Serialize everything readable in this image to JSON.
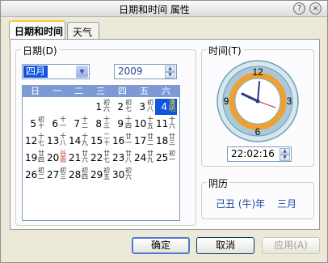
{
  "window": {
    "title": "日期和时间 属性",
    "help_glyph": "?",
    "close_glyph": "×"
  },
  "tabs": [
    {
      "label": "日期和时间",
      "active": true
    },
    {
      "label": "天气",
      "active": false
    }
  ],
  "date_group": {
    "label": "日期(D)",
    "month": "四月",
    "year": "2009",
    "weekdays": [
      "日",
      "一",
      "二",
      "三",
      "四",
      "五",
      "六"
    ],
    "days": [
      [
        null,
        null,
        null,
        {
          "d": "1",
          "l": "初六"
        },
        {
          "d": "2",
          "l": "初七"
        },
        {
          "d": "3",
          "l": "初八"
        },
        {
          "d": "4",
          "l": "清明",
          "selected": true,
          "holiday": true
        }
      ],
      [
        {
          "d": "5",
          "l": "初十"
        },
        {
          "d": "6",
          "l": "十一"
        },
        {
          "d": "7",
          "l": "十二"
        },
        {
          "d": "8",
          "l": "十三"
        },
        {
          "d": "9",
          "l": "十四"
        },
        {
          "d": "10",
          "l": "十五"
        },
        {
          "d": "11",
          "l": "十六"
        }
      ],
      [
        {
          "d": "12",
          "l": "十七"
        },
        {
          "d": "13",
          "l": "十八"
        },
        {
          "d": "14",
          "l": "十九"
        },
        {
          "d": "15",
          "l": "二十"
        },
        {
          "d": "16",
          "l": "廿一"
        },
        {
          "d": "17",
          "l": "廿二"
        },
        {
          "d": "18",
          "l": "廿三"
        }
      ],
      [
        {
          "d": "19",
          "l": "廿四"
        },
        {
          "d": "20",
          "l": "谷雨",
          "holiday": true
        },
        {
          "d": "21",
          "l": "廿六"
        },
        {
          "d": "22",
          "l": "廿七"
        },
        {
          "d": "23",
          "l": "廿八"
        },
        {
          "d": "24",
          "l": "廿九"
        },
        {
          "d": "25",
          "l": "初一"
        }
      ],
      [
        {
          "d": "26",
          "l": "初二"
        },
        {
          "d": "27",
          "l": "初三"
        },
        {
          "d": "28",
          "l": "初四"
        },
        {
          "d": "29",
          "l": "初五"
        },
        {
          "d": "30",
          "l": "初六"
        },
        null,
        null
      ]
    ]
  },
  "time_group": {
    "label": "时间(T)",
    "clock_numbers": [
      "12",
      "3",
      "6",
      "9"
    ],
    "time_value": "22:02:16"
  },
  "lunar_group": {
    "label": "阴历",
    "year": "己丑 (牛)年",
    "month": "三月"
  },
  "buttons": {
    "ok": "确定",
    "cancel": "取消",
    "apply": "应用(A)"
  },
  "colors": {
    "selected_day": "#1254e0",
    "weekday_header": "#7e9ad6",
    "clock_ring": "#a9c9d8",
    "clock_accent": "#f0a030"
  }
}
